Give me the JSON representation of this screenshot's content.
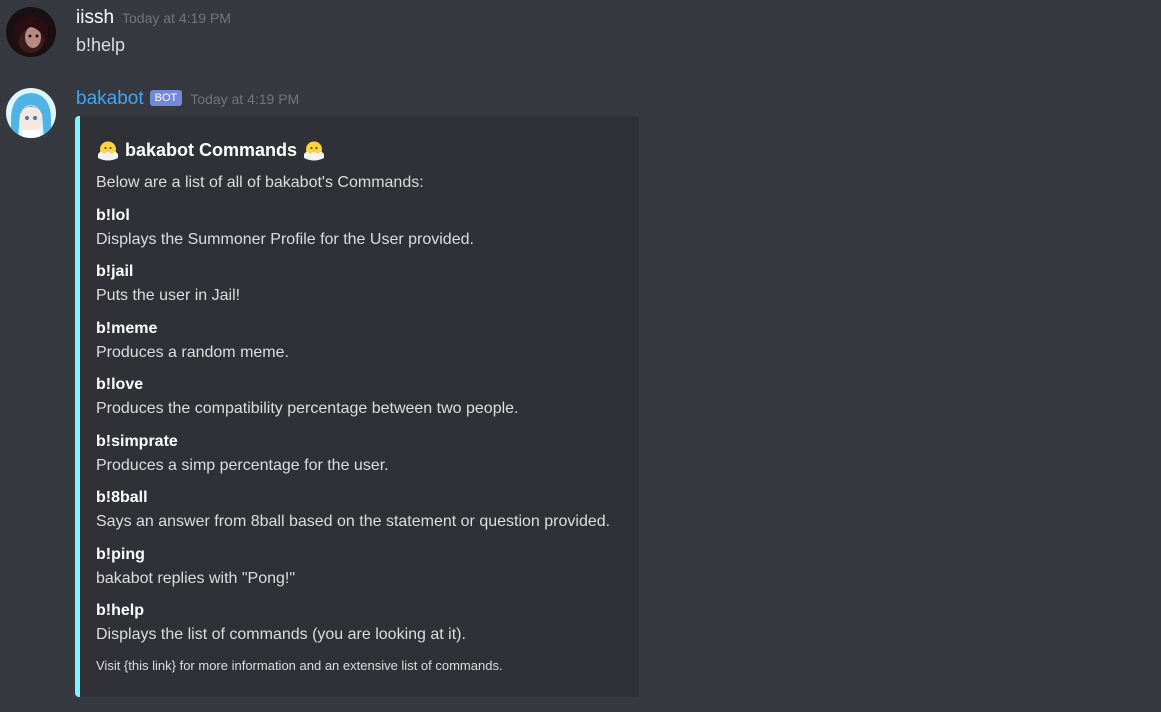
{
  "messages": {
    "first": {
      "username": "iissh",
      "timestamp": "Today at 4:19 PM",
      "content": "b!help"
    },
    "second": {
      "username": "bakabot",
      "bot_tag": "BOT",
      "timestamp": "Today at 4:19 PM",
      "embed": {
        "accent_color": "#7ff2ff",
        "title": "bakabot Commands",
        "title_icon": "chick-emoji-icon",
        "description": "Below are a list of all of bakabot's Commands:",
        "fields": [
          {
            "name": "b!lol",
            "value": "Displays the Summoner Profile for the User provided."
          },
          {
            "name": "b!jail",
            "value": "Puts the user in Jail!"
          },
          {
            "name": "b!meme",
            "value": "Produces a random meme."
          },
          {
            "name": "b!love",
            "value": "Produces the compatibility percentage between two people."
          },
          {
            "name": "b!simprate",
            "value": "Produces a simp percentage for the user."
          },
          {
            "name": "b!8ball",
            "value": "Says an answer from 8ball based on the statement or question provided."
          },
          {
            "name": "b!ping",
            "value": "bakabot replies with \"Pong!\""
          },
          {
            "name": "b!help",
            "value": "Displays the list of commands (you are looking at it)."
          }
        ],
        "footer": "Visit {this link} for more information and an extensive list of commands."
      }
    }
  },
  "colors": {
    "background": "#36393f",
    "embed_background": "#2f3136",
    "bot_name": "#42a5f5",
    "bot_tag": "#7289da",
    "timestamp": "#72767d"
  }
}
